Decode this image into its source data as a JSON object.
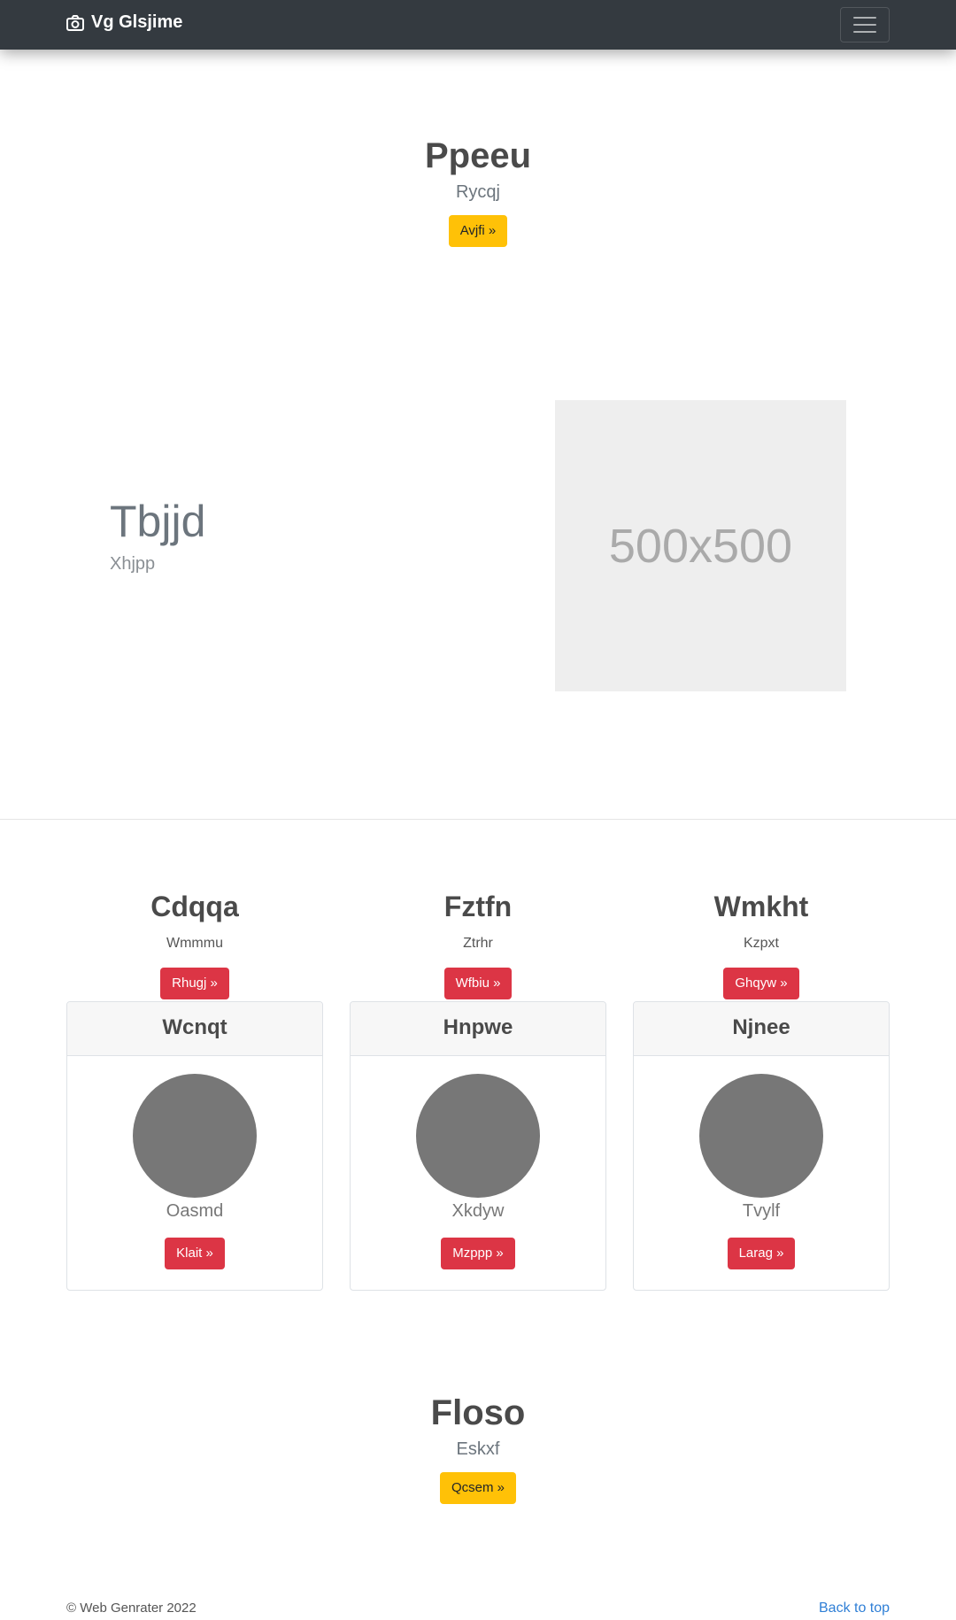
{
  "navbar": {
    "brand": "Vg Glsjime",
    "brand_icon": "camera-icon",
    "toggler_icon": "hamburger-menu-icon"
  },
  "hero": {
    "title": "Ppeeu",
    "subtitle": "Rycqj",
    "button": "Avjfi »"
  },
  "feature": {
    "title": "Tbjjd",
    "subtitle": "Xhjpp",
    "image_label": "500x500"
  },
  "columns": [
    {
      "title": "Cdqqa",
      "text": "Wmmmu",
      "button": "Rhugj »"
    },
    {
      "title": "Fztfn",
      "text": "Ztrhr",
      "button": "Wfbiu »"
    },
    {
      "title": "Wmkht",
      "text": "Kzpxt",
      "button": "Ghqyw »"
    }
  ],
  "cards": [
    {
      "header": "Wcnqt",
      "text": "Oasmd",
      "button": "Klait »"
    },
    {
      "header": "Hnpwe",
      "text": "Xkdyw",
      "button": "Mzppp »"
    },
    {
      "header": "Njnee",
      "text": "Tvylf",
      "button": "Larag »"
    }
  ],
  "cta": {
    "title": "Floso",
    "subtitle": "Eskxf",
    "button": "Qcsem »"
  },
  "footer": {
    "copyright": "© Web Genrater 2022",
    "back_to_top": "Back to top"
  },
  "colors": {
    "navbar": "#343a40",
    "warning": "#ffc107",
    "danger": "#dc3545",
    "link": "#2f7fd6"
  }
}
